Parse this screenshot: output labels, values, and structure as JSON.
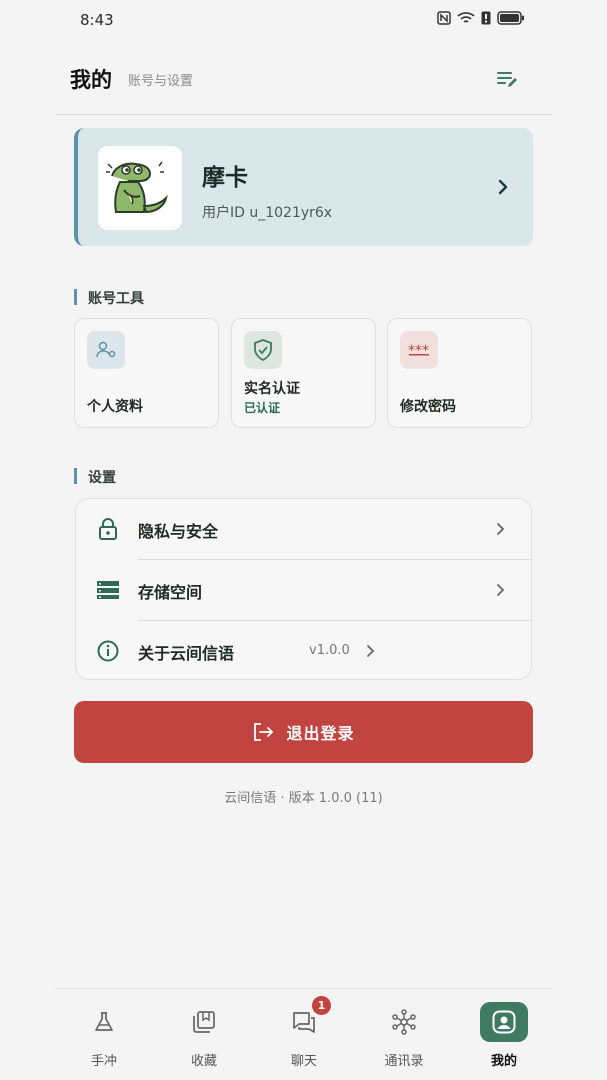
{
  "status_bar": {
    "time": "8:43"
  },
  "header": {
    "title": "我的",
    "subtitle": "账号与设置",
    "action_icon": "edit-list-icon"
  },
  "profile": {
    "name": "摩卡",
    "user_id": "用户ID u_1021yr6x",
    "avatar_icon": "crocodile-avatar"
  },
  "account_tools": {
    "title": "账号工具",
    "items": [
      {
        "label": "个人资料",
        "icon": "user-settings-icon"
      },
      {
        "label": "实名认证",
        "status": "已认证",
        "icon": "shield-check-icon"
      },
      {
        "label": "修改密码",
        "icon": "password-icon"
      }
    ]
  },
  "settings": {
    "title": "设置",
    "items": [
      {
        "label": "隐私与安全",
        "icon": "lock-icon"
      },
      {
        "label": "存储空间",
        "icon": "storage-icon"
      },
      {
        "label": "关于云间信语",
        "value": "v1.0.0",
        "icon": "info-icon"
      }
    ]
  },
  "logout": {
    "label": "退出登录",
    "icon": "logout-icon"
  },
  "version_text": "云间信语 · 版本 1.0.0 (11)",
  "bottom_nav": {
    "items": [
      {
        "label": "手冲",
        "icon": "flask-icon"
      },
      {
        "label": "收藏",
        "icon": "bookmark-collection-icon"
      },
      {
        "label": "聊天",
        "icon": "chat-icon",
        "badge": "1"
      },
      {
        "label": "通讯录",
        "icon": "network-icon"
      },
      {
        "label": "我的",
        "icon": "user-icon",
        "active": true
      }
    ]
  },
  "colors": {
    "accent": "#3f7a63",
    "danger": "#c14440",
    "card": "#d9e6ea",
    "section_bar": "#5d93a8"
  }
}
